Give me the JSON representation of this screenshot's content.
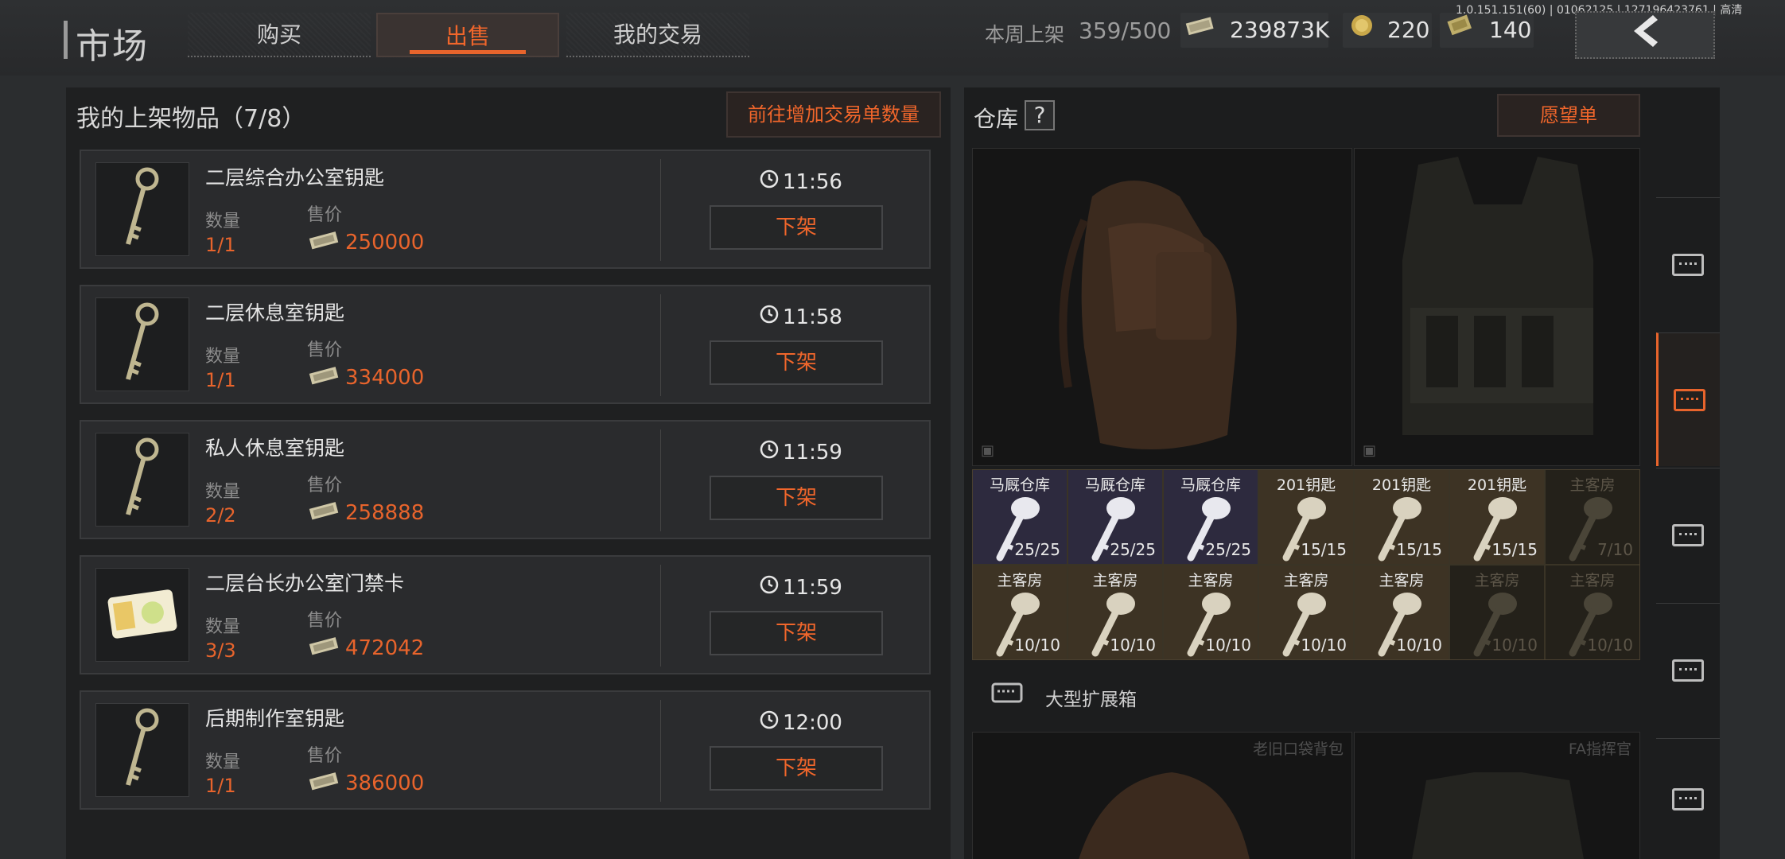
{
  "header": {
    "title": "市场",
    "tabs": [
      {
        "label": "购买"
      },
      {
        "label": "出售"
      },
      {
        "label": "我的交易"
      }
    ],
    "weekly_listing_label": "本周上架",
    "weekly_listing_value": "359/500",
    "currencies": [
      {
        "icon": "cash-icon",
        "value": "239873K"
      },
      {
        "icon": "coin-icon",
        "value": "220"
      },
      {
        "icon": "voucher-icon",
        "value": "140"
      }
    ],
    "version_text": "1.0.151.151(60) | 01062125 | 127196423761 | 高清"
  },
  "listings": {
    "header": "我的上架物品（7/8）",
    "add_orders_label": "前往增加交易单数量",
    "qty_label": "数量",
    "price_label": "售价",
    "unlist_label": "下架",
    "items": [
      {
        "name": "二层综合办公室钥匙",
        "qty": "1/1",
        "price": "250000",
        "time": "11:56",
        "icon": "key-icon"
      },
      {
        "name": "二层休息室钥匙",
        "qty": "1/1",
        "price": "334000",
        "time": "11:58",
        "icon": "key-icon"
      },
      {
        "name": "私人休息室钥匙",
        "qty": "2/2",
        "price": "258888",
        "time": "11:59",
        "icon": "key-icon"
      },
      {
        "name": "二层台长办公室门禁卡",
        "qty": "3/3",
        "price": "472042",
        "time": "11:59",
        "icon": "access-card-icon"
      },
      {
        "name": "后期制作室钥匙",
        "qty": "1/1",
        "price": "386000",
        "time": "12:00",
        "icon": "key-icon"
      }
    ]
  },
  "stash": {
    "label": "仓库",
    "help": "?",
    "wishlist_label": "愿望单",
    "key_slots": [
      {
        "name": "马厩仓库",
        "count": "25/25",
        "style": "purple"
      },
      {
        "name": "马厩仓库",
        "count": "25/25",
        "style": "purple"
      },
      {
        "name": "马厩仓库",
        "count": "25/25",
        "style": "purple"
      },
      {
        "name": "201钥匙",
        "count": "15/15",
        "style": "tan"
      },
      {
        "name": "201钥匙",
        "count": "15/15",
        "style": "tan"
      },
      {
        "name": "201钥匙",
        "count": "15/15",
        "style": "tan"
      },
      {
        "name": "主客房",
        "count": "7/10",
        "style": "dim"
      },
      {
        "name": "主客房",
        "count": "10/10",
        "style": "tan"
      },
      {
        "name": "主客房",
        "count": "10/10",
        "style": "tan"
      },
      {
        "name": "主客房",
        "count": "10/10",
        "style": "tan"
      },
      {
        "name": "主客房",
        "count": "10/10",
        "style": "tan"
      },
      {
        "name": "主客房",
        "count": "10/10",
        "style": "tan"
      },
      {
        "name": "主客房",
        "count": "10/10",
        "style": "dim"
      },
      {
        "name": "主客房",
        "count": "10/10",
        "style": "dim"
      }
    ],
    "expansion_label": "大型扩展箱",
    "lower_slots": [
      {
        "name": "老旧口袋背包"
      },
      {
        "name": "FA指挥官"
      }
    ]
  },
  "colors": {
    "accent": "#e8642c",
    "background": "#2b2d2f",
    "panel": "#1f2021"
  }
}
